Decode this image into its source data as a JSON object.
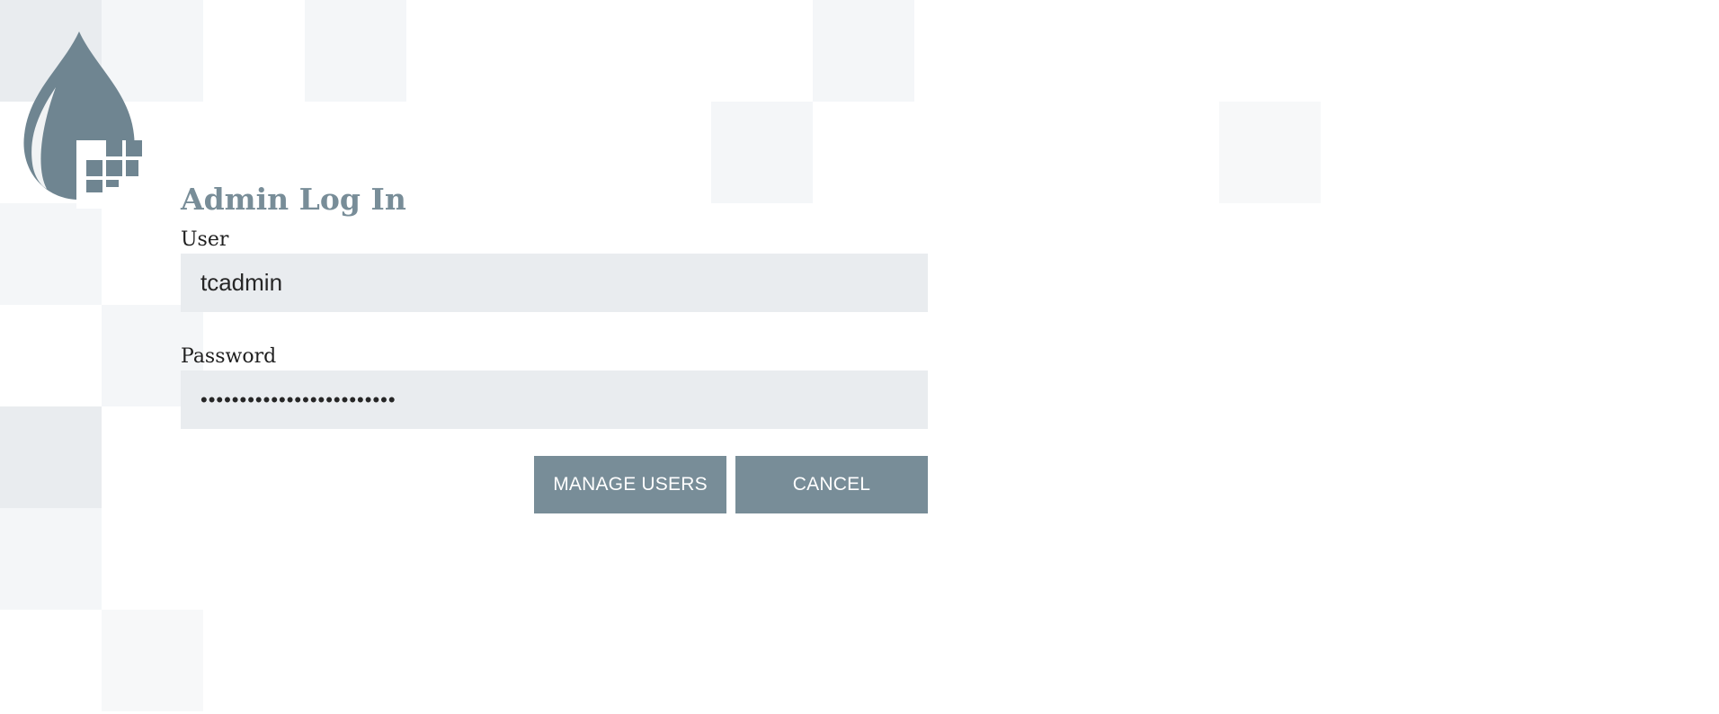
{
  "login": {
    "title": "Admin Log In",
    "user_label": "User",
    "user_value": "tcadmin",
    "password_label": "Password",
    "password_value": "•••••••••••••••••••••••••",
    "manage_users_label": "MANAGE USERS",
    "cancel_label": "CANCEL"
  },
  "icons": {
    "logo": "drop-with-squares-logo"
  },
  "colors": {
    "accent": "#788d98",
    "input_bg": "#e9ecef",
    "text": "#262626"
  }
}
